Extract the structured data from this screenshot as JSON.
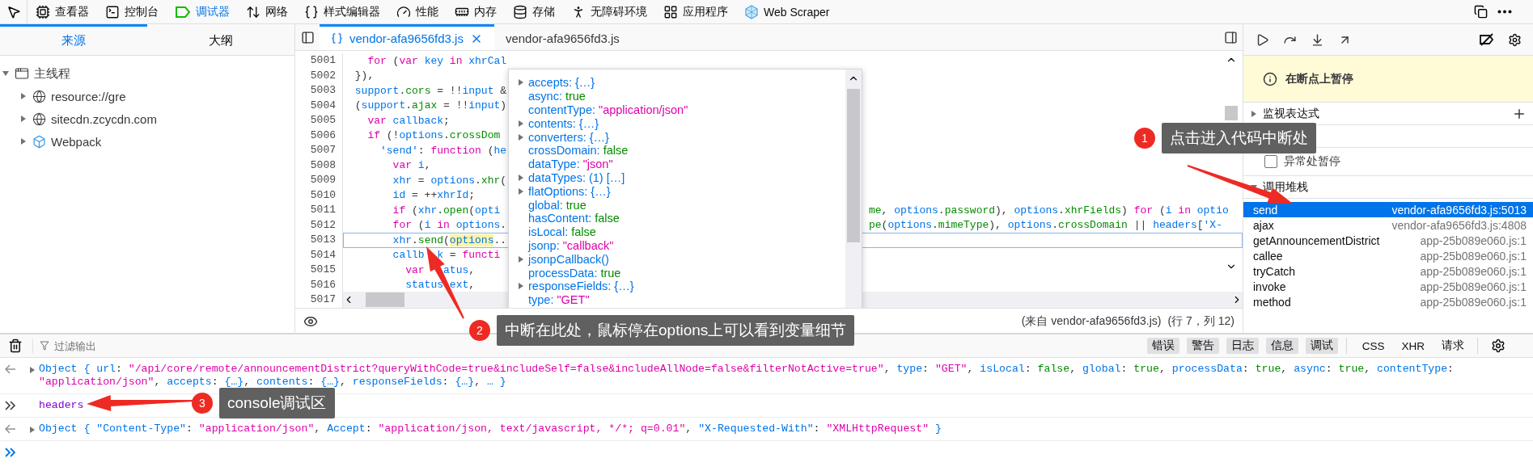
{
  "toolbar": {
    "tools": [
      {
        "label": "查看器",
        "kind": "inspector",
        "selected": false
      },
      {
        "label": "控制台",
        "kind": "console",
        "selected": false
      },
      {
        "label": "调试器",
        "kind": "debugger",
        "selected": true
      },
      {
        "label": "网络",
        "kind": "network",
        "selected": false
      },
      {
        "label": "样式编辑器",
        "kind": "style",
        "selected": false
      },
      {
        "label": "性能",
        "kind": "performance",
        "selected": false
      },
      {
        "label": "内存",
        "kind": "memory",
        "selected": false
      },
      {
        "label": "存储",
        "kind": "storage",
        "selected": false
      },
      {
        "label": "无障碍环境",
        "kind": "accessibility",
        "selected": false
      },
      {
        "label": "应用程序",
        "kind": "application",
        "selected": false
      },
      {
        "label": "Web Scraper",
        "kind": "extension",
        "selected": false
      }
    ]
  },
  "sources_panel": {
    "tabs": [
      {
        "label": "来源",
        "selected": true
      },
      {
        "label": "大纲",
        "selected": false
      }
    ],
    "tree": [
      {
        "label": "主线程",
        "kind": "thread",
        "expanded": true,
        "children": [
          {
            "label": "resource://gre",
            "kind": "host",
            "expanded": false
          },
          {
            "label": "sitecdn.zcycdn.com",
            "kind": "host",
            "expanded": false
          },
          {
            "label": "Webpack",
            "kind": "webpack",
            "expanded": false
          }
        ]
      }
    ]
  },
  "editor": {
    "tabs": [
      {
        "label": "vendor-afa9656fd3.js",
        "selected": true
      },
      {
        "label": "vendor-afa9656fd3.js",
        "selected": false
      }
    ],
    "lines": [
      {
        "number": "5001",
        "current": false,
        "code": [
          {
            "text": "   for",
            "kind": "keyword"
          },
          {
            "text": " (",
            "kind": "plain"
          },
          {
            "text": "var",
            "kind": "keyword"
          },
          {
            "text": " key",
            "kind": "identifier"
          },
          {
            "text": " in",
            "kind": "keyword"
          },
          {
            "text": " xhrCal",
            "kind": "identifier"
          }
        ]
      },
      {
        "number": "5002",
        "current": false,
        "code": [
          {
            "text": " }),",
            "kind": "plain"
          }
        ]
      },
      {
        "number": "5003",
        "current": false,
        "code": [
          {
            "text": " support",
            "kind": "identifier"
          },
          {
            "text": ".",
            "kind": "plain"
          },
          {
            "text": "cors",
            "kind": "property"
          },
          {
            "text": " = !!",
            "kind": "plain"
          },
          {
            "text": "input",
            "kind": "identifier"
          },
          {
            "text": " &",
            "kind": "plain"
          }
        ]
      },
      {
        "number": "5004",
        "current": false,
        "code": [
          {
            "text": " (",
            "kind": "plain"
          },
          {
            "text": "support",
            "kind": "identifier"
          },
          {
            "text": ".",
            "kind": "plain"
          },
          {
            "text": "ajax",
            "kind": "property"
          },
          {
            "text": " = !!",
            "kind": "plain"
          },
          {
            "text": "input",
            "kind": "identifier"
          },
          {
            "text": ")",
            "kind": "plain"
          }
        ]
      },
      {
        "number": "5005",
        "current": false,
        "code": [
          {
            "text": "   var",
            "kind": "keyword"
          },
          {
            "text": " callback",
            "kind": "identifier"
          },
          {
            "text": ";",
            "kind": "plain"
          }
        ]
      },
      {
        "number": "5006",
        "current": false,
        "code": [
          {
            "text": "   if",
            "kind": "keyword"
          },
          {
            "text": " (!",
            "kind": "plain"
          },
          {
            "text": "options",
            "kind": "identifier"
          },
          {
            "text": ".",
            "kind": "plain"
          },
          {
            "text": "crossDom",
            "kind": "property"
          }
        ]
      },
      {
        "number": "5007",
        "current": false,
        "code": [
          {
            "text": "     'send'",
            "kind": "identifier"
          },
          {
            "text": ": ",
            "kind": "plain"
          },
          {
            "text": "function",
            "kind": "keyword"
          },
          {
            "text": " (",
            "kind": "plain"
          },
          {
            "text": "he",
            "kind": "identifier"
          }
        ]
      },
      {
        "number": "5008",
        "current": false,
        "code": [
          {
            "text": "       var",
            "kind": "keyword"
          },
          {
            "text": " i",
            "kind": "identifier"
          },
          {
            "text": ",",
            "kind": "plain"
          }
        ]
      },
      {
        "number": "5009",
        "current": false,
        "code": [
          {
            "text": "       xhr",
            "kind": "identifier"
          },
          {
            "text": " = ",
            "kind": "plain"
          },
          {
            "text": "options",
            "kind": "identifier"
          },
          {
            "text": ".",
            "kind": "plain"
          },
          {
            "text": "xhr",
            "kind": "property"
          },
          {
            "text": "(",
            "kind": "plain"
          }
        ]
      },
      {
        "number": "5010",
        "current": false,
        "code": [
          {
            "text": "       id",
            "kind": "identifier"
          },
          {
            "text": " = ++",
            "kind": "plain"
          },
          {
            "text": "xhrId",
            "kind": "identifier"
          },
          {
            "text": ";",
            "kind": "plain"
          }
        ]
      },
      {
        "number": "5011",
        "current": false,
        "code": [
          {
            "text": "       if",
            "kind": "keyword"
          },
          {
            "text": " (",
            "kind": "plain"
          },
          {
            "text": "xhr",
            "kind": "identifier"
          },
          {
            "text": ".",
            "kind": "plain"
          },
          {
            "text": "open",
            "kind": "property"
          },
          {
            "text": "(",
            "kind": "plain"
          },
          {
            "text": "opti",
            "kind": "identifier"
          }
        ],
        "tail": [
          {
            "text": "me",
            "kind": "property"
          },
          {
            "text": ", ",
            "kind": "plain"
          },
          {
            "text": "options",
            "kind": "identifier"
          },
          {
            "text": ".",
            "kind": "plain"
          },
          {
            "text": "password",
            "kind": "property"
          },
          {
            "text": "), ",
            "kind": "plain"
          },
          {
            "text": "options",
            "kind": "identifier"
          },
          {
            "text": ".",
            "kind": "plain"
          },
          {
            "text": "xhrFields",
            "kind": "property"
          },
          {
            "text": ") ",
            "kind": "plain"
          },
          {
            "text": "for",
            "kind": "keyword"
          },
          {
            "text": " (",
            "kind": "plain"
          },
          {
            "text": "i",
            "kind": "identifier"
          },
          {
            "text": " in",
            "kind": "keyword"
          },
          {
            "text": " optio",
            "kind": "identifier"
          }
        ]
      },
      {
        "number": "5012",
        "current": false,
        "code": [
          {
            "text": "       for",
            "kind": "keyword"
          },
          {
            "text": " (",
            "kind": "plain"
          },
          {
            "text": "i",
            "kind": "identifier"
          },
          {
            "text": " in",
            "kind": "keyword"
          },
          {
            "text": " options",
            "kind": "identifier"
          },
          {
            "text": ".",
            "kind": "plain"
          }
        ],
        "tail": [
          {
            "text": "pe",
            "kind": "property"
          },
          {
            "text": "(",
            "kind": "plain"
          },
          {
            "text": "options",
            "kind": "identifier"
          },
          {
            "text": ".",
            "kind": "plain"
          },
          {
            "text": "mimeType",
            "kind": "property"
          },
          {
            "text": "), ",
            "kind": "plain"
          },
          {
            "text": "options",
            "kind": "identifier"
          },
          {
            "text": ".",
            "kind": "plain"
          },
          {
            "text": "crossDomain",
            "kind": "property"
          },
          {
            "text": " || ",
            "kind": "plain"
          },
          {
            "text": "headers",
            "kind": "identifier"
          },
          {
            "text": "[",
            "kind": "plain"
          },
          {
            "text": "'X-",
            "kind": "identifier"
          }
        ]
      },
      {
        "number": "5013",
        "current": true,
        "code": [
          {
            "text": "       xhr",
            "kind": "identifier"
          },
          {
            "text": ".",
            "kind": "plain"
          },
          {
            "text": "send",
            "kind": "property"
          },
          {
            "text": "(",
            "kind": "plain"
          },
          {
            "text": "options",
            "kind": "match"
          },
          {
            "text": "..",
            "kind": "plain"
          }
        ]
      },
      {
        "number": "5014",
        "current": false,
        "code": [
          {
            "text": "       callb",
            "kind": "identifier"
          },
          {
            "text": "  k",
            "kind": "identifier"
          },
          {
            "text": " = ",
            "kind": "plain"
          },
          {
            "text": "functi",
            "kind": "keyword"
          }
        ]
      },
      {
        "number": "5015",
        "current": false,
        "code": [
          {
            "text": "         var",
            "kind": "keyword"
          },
          {
            "text": "   atus",
            "kind": "identifier"
          },
          {
            "text": ",",
            "kind": "plain"
          }
        ]
      },
      {
        "number": "5016",
        "current": false,
        "code": [
          {
            "text": "         status",
            "kind": "identifier"
          },
          {
            "text": " ext",
            "kind": "identifier"
          },
          {
            "text": ",",
            "kind": "plain"
          }
        ]
      },
      {
        "number": "5017"
      }
    ],
    "popup": [
      {
        "key": "accepts:",
        "value": "{…}",
        "kind": "object",
        "expandable": true
      },
      {
        "key": "async:",
        "value": "true",
        "kind": "boolean",
        "expandable": false
      },
      {
        "key": "contentType:",
        "value": "\"application/json\"",
        "kind": "string",
        "expandable": false
      },
      {
        "key": "contents:",
        "value": "{…}",
        "kind": "object",
        "expandable": true
      },
      {
        "key": "converters:",
        "value": "{…}",
        "kind": "object",
        "expandable": true
      },
      {
        "key": "crossDomain:",
        "value": "false",
        "kind": "boolean",
        "expandable": false
      },
      {
        "key": "dataType:",
        "value": "\"json\"",
        "kind": "string",
        "expandable": false
      },
      {
        "key": "dataTypes:",
        "value": "(1) […]",
        "kind": "array",
        "expandable": true
      },
      {
        "key": "flatOptions:",
        "value": "{…}",
        "kind": "object",
        "expandable": true
      },
      {
        "key": "global:",
        "value": "true",
        "kind": "boolean",
        "expandable": false
      },
      {
        "key": "hasContent:",
        "value": "false",
        "kind": "boolean",
        "expandable": false
      },
      {
        "key": "isLocal:",
        "value": "false",
        "kind": "boolean",
        "expandable": false
      },
      {
        "key": "jsonp:",
        "value": "\"callback\"",
        "kind": "string",
        "expandable": false
      },
      {
        "key": "jsonpCallback()",
        "expandable": true
      },
      {
        "key": "processData:",
        "value": "true",
        "kind": "boolean",
        "expandable": false
      },
      {
        "key": "responseFields:",
        "value": "{…}",
        "kind": "object",
        "expandable": true
      },
      {
        "key": "type:",
        "value": "\"GET\"",
        "kind": "string",
        "expandable": false
      }
    ],
    "footer": {
      "source": "(来自 vendor-afa9656fd3.js)",
      "position": "(行 7，列 12)"
    }
  },
  "debug_panel": {
    "paused_message": "在断点上暂停",
    "sections": [
      {
        "title": "监视表达式",
        "kind": "watch",
        "expanded": false
      },
      {
        "kind": "breakpoints",
        "option": {
          "label": "异常处暂停",
          "checked": false
        }
      },
      {
        "title": "调用堆栈",
        "kind": "callstack",
        "expanded": true,
        "frames": [
          {
            "name": "send",
            "location": "vendor-afa9656fd3.js:5013",
            "selected": true
          },
          {
            "name": "ajax",
            "location": "vendor-afa9656fd3.js:4808",
            "selected": false
          },
          {
            "name": "getAnnouncementDistrict",
            "location": "app-25b089e060.js:1",
            "selected": false
          },
          {
            "name": "callee",
            "location": "app-25b089e060.js:1",
            "selected": false
          },
          {
            "name": "tryCatch",
            "location": "app-25b089e060.js:1",
            "selected": false
          },
          {
            "name": "invoke",
            "location": "app-25b089e060.js:1",
            "selected": false
          },
          {
            "name": "method",
            "location": "app-25b089e060.js:1",
            "selected": false
          }
        ]
      }
    ]
  },
  "console": {
    "filter": {
      "placeholder": "过滤输出"
    },
    "levels": [
      {
        "label": "错误",
        "selected": true
      },
      {
        "label": "警告",
        "selected": true
      },
      {
        "label": "日志",
        "selected": true
      },
      {
        "label": "信息",
        "selected": true
      },
      {
        "label": "调试",
        "selected": true
      }
    ],
    "types": [
      {
        "label": "CSS",
        "selected": false
      },
      {
        "label": "XHR",
        "selected": false
      },
      {
        "label": "请求",
        "selected": false
      }
    ],
    "messages": [
      {
        "kind": "result",
        "lines": [
          [
            {
              "text": "Object {",
              "kind": "identifier"
            },
            {
              "text": " url",
              "kind": "identifier"
            },
            {
              "text": ": ",
              "kind": "plain"
            },
            {
              "text": "\"/api/core/remote/announcementDistrict?queryWithCode=true&includeSelf=false&includeAllNode=false&filterNotActive=true\"",
              "kind": "string"
            },
            {
              "text": ", ",
              "kind": "plain"
            },
            {
              "text": "type",
              "kind": "identifier"
            },
            {
              "text": ": ",
              "kind": "plain"
            },
            {
              "text": "\"GET\"",
              "kind": "string"
            },
            {
              "text": ", ",
              "kind": "plain"
            },
            {
              "text": "isLocal",
              "kind": "identifier"
            },
            {
              "text": ": ",
              "kind": "plain"
            },
            {
              "text": "false",
              "kind": "boolean"
            },
            {
              "text": ", ",
              "kind": "plain"
            },
            {
              "text": "global",
              "kind": "identifier"
            },
            {
              "text": ": ",
              "kind": "plain"
            },
            {
              "text": "true",
              "kind": "boolean"
            },
            {
              "text": ", ",
              "kind": "plain"
            },
            {
              "text": "processData",
              "kind": "identifier"
            },
            {
              "text": ": ",
              "kind": "plain"
            },
            {
              "text": "true",
              "kind": "boolean"
            },
            {
              "text": ", ",
              "kind": "plain"
            },
            {
              "text": "async",
              "kind": "identifier"
            },
            {
              "text": ": ",
              "kind": "plain"
            },
            {
              "text": "true",
              "kind": "boolean"
            },
            {
              "text": ", ",
              "kind": "plain"
            },
            {
              "text": "contentType",
              "kind": "identifier"
            },
            {
              "text": ":",
              "kind": "plain"
            }
          ],
          [
            {
              "text": "\"application/json\"",
              "kind": "string"
            },
            {
              "text": ", ",
              "kind": "plain"
            },
            {
              "text": "accepts",
              "kind": "identifier"
            },
            {
              "text": ": ",
              "kind": "plain"
            },
            {
              "text": "{…}",
              "kind": "identifier"
            },
            {
              "text": ", ",
              "kind": "plain"
            },
            {
              "text": "contents",
              "kind": "identifier"
            },
            {
              "text": ": ",
              "kind": "plain"
            },
            {
              "text": "{…}",
              "kind": "identifier"
            },
            {
              "text": ", ",
              "kind": "plain"
            },
            {
              "text": "responseFields",
              "kind": "identifier"
            },
            {
              "text": ": ",
              "kind": "plain"
            },
            {
              "text": "{…}",
              "kind": "identifier"
            },
            {
              "text": ", ",
              "kind": "plain"
            },
            {
              "text": "… }",
              "kind": "identifier"
            }
          ]
        ]
      },
      {
        "kind": "input",
        "lines": [
          [
            {
              "text": "headers",
              "kind": "input"
            }
          ]
        ]
      },
      {
        "kind": "result",
        "lines": [
          [
            {
              "text": "Object {",
              "kind": "identifier"
            },
            {
              "text": " \"Content-Type\"",
              "kind": "identifier"
            },
            {
              "text": ": ",
              "kind": "plain"
            },
            {
              "text": "\"application/json\"",
              "kind": "string"
            },
            {
              "text": ", ",
              "kind": "plain"
            },
            {
              "text": "Accept",
              "kind": "identifier"
            },
            {
              "text": ": ",
              "kind": "plain"
            },
            {
              "text": "\"application/json, text/javascript, */*; q=0.01\"",
              "kind": "string"
            },
            {
              "text": ", ",
              "kind": "plain"
            },
            {
              "text": "\"X-Requested-With\"",
              "kind": "identifier"
            },
            {
              "text": ": ",
              "kind": "plain"
            },
            {
              "text": "\"XMLHttpRequest\"",
              "kind": "string"
            },
            {
              "text": " }",
              "kind": "identifier"
            }
          ]
        ]
      },
      {
        "kind": "prompt"
      }
    ]
  },
  "annotations": [
    {
      "number": "1",
      "text": "点击进入代码中断处"
    },
    {
      "number": "2",
      "text": "中断在此处，鼠标停在options上可以看到变量细节"
    },
    {
      "number": "3",
      "text": "console调试区"
    }
  ]
}
